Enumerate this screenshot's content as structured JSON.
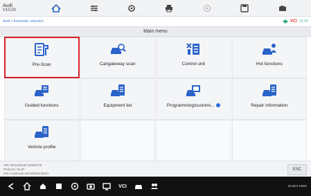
{
  "topbar": {
    "vehicle_make": "Audi",
    "vehicle_sub": "V10.00",
    "icons": [
      "home-icon",
      "car-shortcut-icon",
      "settings-icon",
      "print-icon",
      "help-icon",
      "save-icon",
      "data-icon"
    ]
  },
  "breadcrumb": "Audi > Automatic selection",
  "status": {
    "vci": "VCI",
    "battery": "13.1V"
  },
  "title": "Main menu",
  "tiles": [
    {
      "label": "Pre-Scan",
      "icon": "document-wrench-icon",
      "highlight": true
    },
    {
      "label": "Cangateway scan",
      "icon": "car-search-icon"
    },
    {
      "label": "Control unit",
      "icon": "control-unit-icon"
    },
    {
      "label": "Hot functions",
      "icon": "car-person-icon"
    },
    {
      "label": "Guided functions",
      "icon": "car-guide-icon"
    },
    {
      "label": "Equipment list",
      "icon": "car-list-icon"
    },
    {
      "label": "Programming/customi...",
      "icon": "car-programming-icon",
      "info": true
    },
    {
      "label": "Repair information",
      "icon": "car-info-icon"
    },
    {
      "label": "Vehicle profile",
      "icon": "car-profile-icon"
    }
  ],
  "bottom_info": {
    "line1": "VIN: WAUZZZ4F1AN00178",
    "line2": "Protocol: VLLP",
    "line3": "Info: Audi/Audi A6/A6/RS6 2010+"
  },
  "esc_label": "ESC",
  "android_nav": {
    "icons": [
      "back-icon",
      "home-icon",
      "overview-icon",
      "menu-icon",
      "clock-icon",
      "camera-icon",
      "screen-icon"
    ],
    "vci_label": "VCI",
    "status_text": "10:48 ▾ 100%"
  },
  "colors": {
    "accent": "#2b6fd8",
    "highlight": "#d81f26",
    "icon": "#2a63c9"
  }
}
